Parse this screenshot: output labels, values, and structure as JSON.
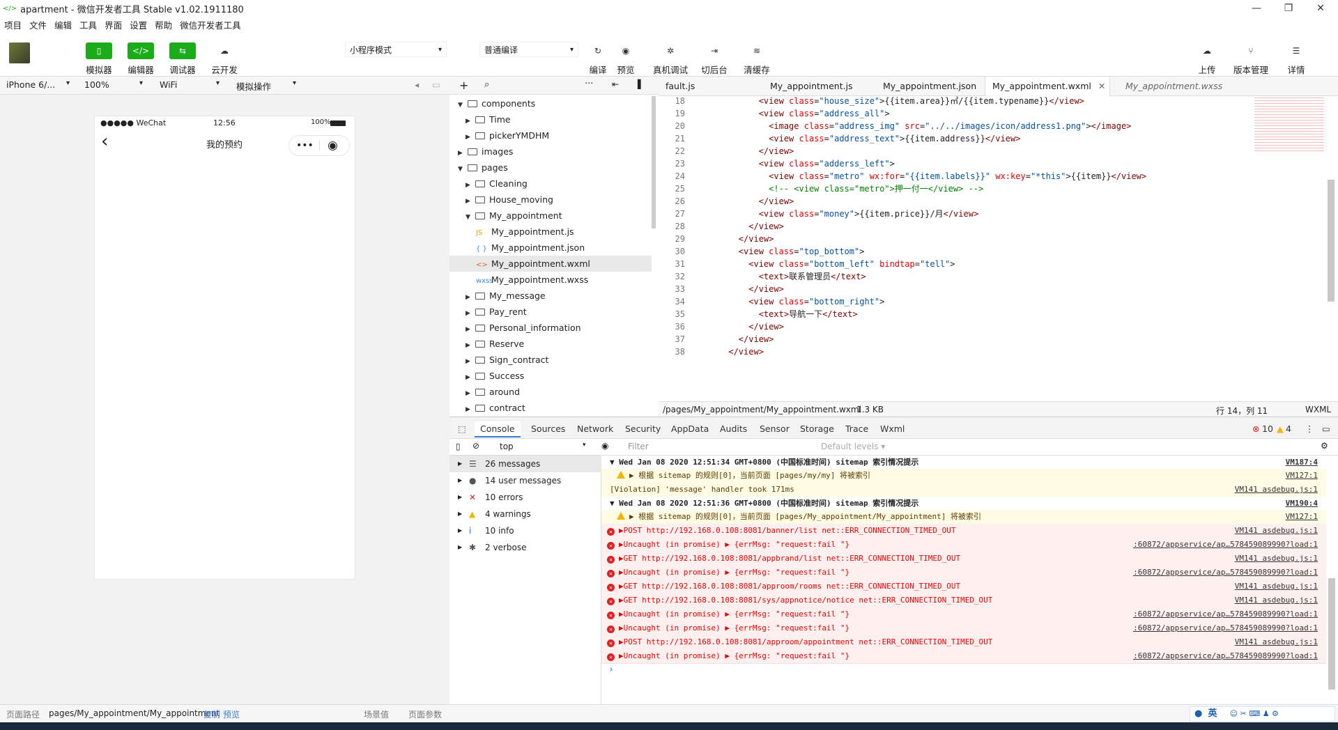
{
  "window": {
    "title": "apartment - 微信开发者工具 Stable v1.02.1911180",
    "min": "—",
    "max": "❐",
    "close": "✕"
  },
  "menu": [
    "项目",
    "文件",
    "编辑",
    "工具",
    "界面",
    "设置",
    "帮助",
    "微信开发者工具"
  ],
  "toolbar": {
    "left": [
      {
        "icon": "▯",
        "label": "模拟器"
      },
      {
        "icon": "</>",
        "label": "编辑器"
      },
      {
        "icon": "⇆",
        "label": "调试器"
      },
      {
        "icon": "☁",
        "label": "云开发"
      }
    ],
    "mode": "小程序模式",
    "compile": "普通编译",
    "right": [
      {
        "icon": "↻",
        "label": "编译"
      },
      {
        "icon": "◉",
        "label": "预览"
      },
      {
        "icon": "✲",
        "label": "真机调试"
      },
      {
        "icon": "⇥",
        "label": "切后台"
      },
      {
        "icon": "≋",
        "label": "清缓存"
      }
    ],
    "far": [
      {
        "icon": "☁",
        "label": "上传"
      },
      {
        "icon": "⑂",
        "label": "版本管理"
      },
      {
        "icon": "☰",
        "label": "详情"
      }
    ]
  },
  "sim": {
    "device": "iPhone 6/...",
    "zoom": "100%",
    "network": "WiFi",
    "op": "模拟操作",
    "phone": {
      "carrier": "●●●●● WeChat",
      "time": "12:56",
      "battery": "100%",
      "title": "我的预约",
      "back": "‹",
      "more": "•••",
      "record": "◉"
    }
  },
  "tree": [
    {
      "type": "folder",
      "open": true,
      "depth": 0,
      "name": "components"
    },
    {
      "type": "folder",
      "open": false,
      "depth": 1,
      "name": "Time"
    },
    {
      "type": "folder",
      "open": false,
      "depth": 1,
      "name": "pickerYMDHM"
    },
    {
      "type": "folder",
      "open": false,
      "depth": 0,
      "name": "images"
    },
    {
      "type": "folder",
      "open": true,
      "depth": 0,
      "name": "pages"
    },
    {
      "type": "folder",
      "open": false,
      "depth": 1,
      "name": "Cleaning"
    },
    {
      "type": "folder",
      "open": false,
      "depth": 1,
      "name": "House_moving"
    },
    {
      "type": "folder",
      "open": true,
      "depth": 1,
      "name": "My_appointment"
    },
    {
      "type": "file",
      "depth": 2,
      "badge": "JS",
      "name": "My_appointment.js",
      "color": "#e8a200"
    },
    {
      "type": "file",
      "depth": 2,
      "badge": "{ }",
      "name": "My_appointment.json",
      "color": "#3a8ee6"
    },
    {
      "type": "file",
      "depth": 2,
      "badge": "<>",
      "name": "My_appointment.wxml",
      "color": "#e25b2a",
      "selected": true
    },
    {
      "type": "file",
      "depth": 2,
      "badge": "wxss",
      "name": "My_appointment.wxss",
      "color": "#3a8ee6"
    },
    {
      "type": "folder",
      "open": false,
      "depth": 1,
      "name": "My_message"
    },
    {
      "type": "folder",
      "open": false,
      "depth": 1,
      "name": "Pay_rent"
    },
    {
      "type": "folder",
      "open": false,
      "depth": 1,
      "name": "Personal_information"
    },
    {
      "type": "folder",
      "open": false,
      "depth": 1,
      "name": "Reserve"
    },
    {
      "type": "folder",
      "open": false,
      "depth": 1,
      "name": "Sign_contract"
    },
    {
      "type": "folder",
      "open": false,
      "depth": 1,
      "name": "Success"
    },
    {
      "type": "folder",
      "open": false,
      "depth": 1,
      "name": "around"
    },
    {
      "type": "folder",
      "open": false,
      "depth": 1,
      "name": "contract"
    }
  ],
  "tabs": [
    "fault.js",
    "My_appointment.js",
    "My_appointment.json",
    "My_appointment.wxml",
    "My_appointment.wxss"
  ],
  "code": [
    {
      "n": "18",
      "h": "            <span class=tg>&lt;view</span> <span class=at>class</span>=<span class=vl>\"house_size\"</span>&gt;{{item.area}}㎡/{{item.typename}}<span class=tg>&lt;/view&gt;</span>"
    },
    {
      "n": "19",
      "h": "            <span class=tg>&lt;view</span> <span class=at>class</span>=<span class=vl>\"address_all\"</span>&gt;"
    },
    {
      "n": "20",
      "h": "              <span class=tg>&lt;image</span> <span class=at>class</span>=<span class=vl>\"address_img\"</span> <span class=at>src</span>=<span class=vl>\"../../images/icon/address1.png\"</span>&gt;<span class=tg>&lt;/image&gt;</span>"
    },
    {
      "n": "21",
      "h": "              <span class=tg>&lt;view</span> <span class=at>class</span>=<span class=vl>\"address_text\"</span>&gt;{{item.address}}<span class=tg>&lt;/view&gt;</span>"
    },
    {
      "n": "22",
      "h": "            <span class=tg>&lt;/view&gt;</span>"
    },
    {
      "n": "23",
      "h": "            <span class=tg>&lt;view</span> <span class=at>class</span>=<span class=vl>\"adderss_left\"</span>&gt;"
    },
    {
      "n": "24",
      "h": "              <span class=tg>&lt;view</span> <span class=at>class</span>=<span class=vl>\"metro\"</span> <span class=at>wx:for</span>=<span class=vl>\"{{item.labels}}\"</span> <span class=at>wx:key</span>=<span class=vl>\"*this\"</span>&gt;{{item}}<span class=tg>&lt;/view&gt;</span>"
    },
    {
      "n": "25",
      "h": "              <span class=cm>&lt;!-- &lt;view class=\"metro\"&gt;押一付一&lt;/view&gt; --&gt;</span>"
    },
    {
      "n": "26",
      "h": "            <span class=tg>&lt;/view&gt;</span>"
    },
    {
      "n": "27",
      "h": "            <span class=tg>&lt;view</span> <span class=at>class</span>=<span class=vl>\"money\"</span>&gt;{{item.price}}/月<span class=tg>&lt;/view&gt;</span>"
    },
    {
      "n": "28",
      "h": "          <span class=tg>&lt;/view&gt;</span>"
    },
    {
      "n": "29",
      "h": "        <span class=tg>&lt;/view&gt;</span>"
    },
    {
      "n": "30",
      "h": "        <span class=tg>&lt;view</span> <span class=at>class</span>=<span class=vl>\"top_bottom\"</span>&gt;"
    },
    {
      "n": "31",
      "h": "          <span class=tg>&lt;view</span> <span class=at>class</span>=<span class=vl>\"bottom_left\"</span> <span class=at>bindtap</span>=<span class=vl>\"tell\"</span>&gt;"
    },
    {
      "n": "32",
      "h": "            <span class=tg>&lt;text&gt;</span>联系管理员<span class=tg>&lt;/text&gt;</span>"
    },
    {
      "n": "33",
      "h": "          <span class=tg>&lt;/view&gt;</span>"
    },
    {
      "n": "34",
      "h": "          <span class=tg>&lt;view</span> <span class=at>class</span>=<span class=vl>\"bottom_right\"</span>&gt;"
    },
    {
      "n": "35",
      "h": "            <span class=tg>&lt;text&gt;</span>导航一下<span class=tg>&lt;/text&gt;</span>"
    },
    {
      "n": "36",
      "h": "          <span class=tg>&lt;/view&gt;</span>"
    },
    {
      "n": "37",
      "h": "        <span class=tg>&lt;/view&gt;</span>"
    },
    {
      "n": "38",
      "h": "      <span class=tg>&lt;/view&gt;</span>"
    }
  ],
  "status": {
    "path": "/pages/My_appointment/My_appointment.wxml",
    "size": "1.3 KB",
    "pos": "行 14，列 11",
    "lang": "WXML"
  },
  "devtabs": [
    "Console",
    "Sources",
    "Network",
    "Security",
    "AppData",
    "Audits",
    "Sensor",
    "Storage",
    "Trace",
    "Wxml"
  ],
  "devcounts": {
    "errors": "10",
    "warnings": "4"
  },
  "filter": {
    "context": "top",
    "placeholder": "Filter",
    "levels": "Default levels ▾"
  },
  "sidebar": [
    {
      "icon": "☰",
      "label": "26 messages"
    },
    {
      "icon": "●",
      "label": "14 user messages"
    },
    {
      "icon": "✕",
      "label": "10 errors"
    },
    {
      "icon": "▲",
      "label": "4 warnings"
    },
    {
      "icon": "i",
      "label": "10 info"
    },
    {
      "icon": "✱",
      "label": "2 verbose"
    }
  ],
  "console": [
    {
      "k": "grp",
      "t": "▼ Wed Jan 08 2020 12:51:34 GMT+0800 (中国标准时间) sitemap 索引情况提示",
      "s": "VM187:4"
    },
    {
      "k": "warn",
      "t": "▶ 根据 sitemap 的规则[0]，当前页面 [pages/my/my] 将被索引",
      "s": "VM127:1"
    },
    {
      "k": "viol",
      "t": "[Violation] 'message' handler took 171ms",
      "s": "VM141 asdebug.js:1"
    },
    {
      "k": "grp",
      "t": "▼ Wed Jan 08 2020 12:51:36 GMT+0800 (中国标准时间) sitemap 索引情况提示",
      "s": "VM190:4"
    },
    {
      "k": "warn",
      "t": "▶ 根据 sitemap 的规则[0]，当前页面 [pages/My_appointment/My_appointment] 将被索引",
      "s": "VM127:1"
    },
    {
      "k": "err",
      "t": "▶POST http://192.168.0.108:8081/banner/list net::ERR_CONNECTION_TIMED_OUT",
      "s": "VM141 asdebug.js:1"
    },
    {
      "k": "err",
      "t": "▶Uncaught (in promise) ▶ {errMsg: \"request:fail \"}",
      "s": ":60872/appservice/ap…578459089990?load:1"
    },
    {
      "k": "err",
      "t": "▶GET http://192.168.0.108:8081/appbrand/list net::ERR_CONNECTION_TIMED_OUT",
      "s": "VM141 asdebug.js:1"
    },
    {
      "k": "err",
      "t": "▶Uncaught (in promise) ▶ {errMsg: \"request:fail \"}",
      "s": ":60872/appservice/ap…578459089990?load:1"
    },
    {
      "k": "err",
      "t": "▶GET http://192.168.0.108:8081/approom/rooms net::ERR_CONNECTION_TIMED_OUT",
      "s": "VM141 asdebug.js:1"
    },
    {
      "k": "err",
      "t": "▶GET http://192.168.0.108:8081/sys/appnotice/notice net::ERR_CONNECTION_TIMED_OUT",
      "s": "VM141 asdebug.js:1"
    },
    {
      "k": "err",
      "t": "▶Uncaught (in promise) ▶ {errMsg: \"request:fail \"}",
      "s": ":60872/appservice/ap…578459089990?load:1"
    },
    {
      "k": "err",
      "t": "▶Uncaught (in promise) ▶ {errMsg: \"request:fail \"}",
      "s": ":60872/appservice/ap…578459089990?load:1"
    },
    {
      "k": "err",
      "t": "▶POST http://192.168.0.108:8081/approom/appointment net::ERR_CONNECTION_TIMED_OUT",
      "s": "VM141 asdebug.js:1"
    },
    {
      "k": "err",
      "t": "▶Uncaught (in promise) ▶ {errMsg: \"request:fail \"}",
      "s": ":60872/appservice/ap…578459089990?load:1"
    }
  ],
  "prompt": "›",
  "bottom": {
    "label": "页面路径",
    "path": "pages/My_appointment/My_appointment",
    "copy": "复制",
    "preview": "预览",
    "scene": "场景值",
    "params": "页面参数"
  },
  "ime": {
    "lang": "英"
  }
}
